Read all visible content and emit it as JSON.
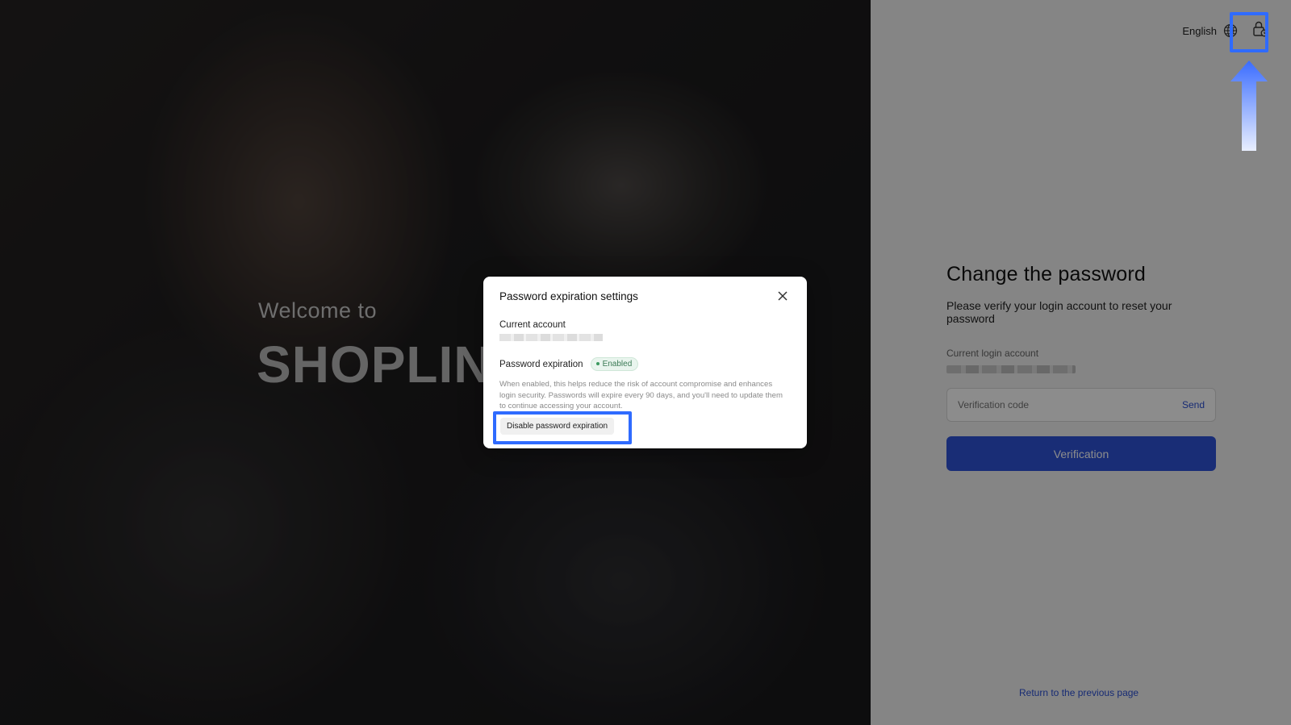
{
  "hero": {
    "welcome": "Welcome to",
    "brand_bold": "SHOPLIN",
    "brand_rest": ""
  },
  "header": {
    "language": "English",
    "language_icon": "globe-icon",
    "security_icon": "lock-settings-icon"
  },
  "form": {
    "title": "Change the password",
    "subtitle": "Please verify your login account to reset your password",
    "account_label": "Current login account",
    "code_placeholder": "Verification code",
    "send_label": "Send",
    "submit_label": "Verification",
    "return_link": "Return to the previous page"
  },
  "modal": {
    "title": "Password expiration settings",
    "account_label": "Current account",
    "expiration_label": "Password expiration",
    "status_badge": "Enabled",
    "description": "When enabled, this helps reduce the risk of account compromise and enhances login security. Passwords will expire every 90 days, and you'll need to update them to continue accessing your account.",
    "disable_button": "Disable password expiration"
  },
  "colors": {
    "primary": "#2f53d8",
    "highlight": "#2f6bff",
    "badge_green": "#3b7a55"
  }
}
